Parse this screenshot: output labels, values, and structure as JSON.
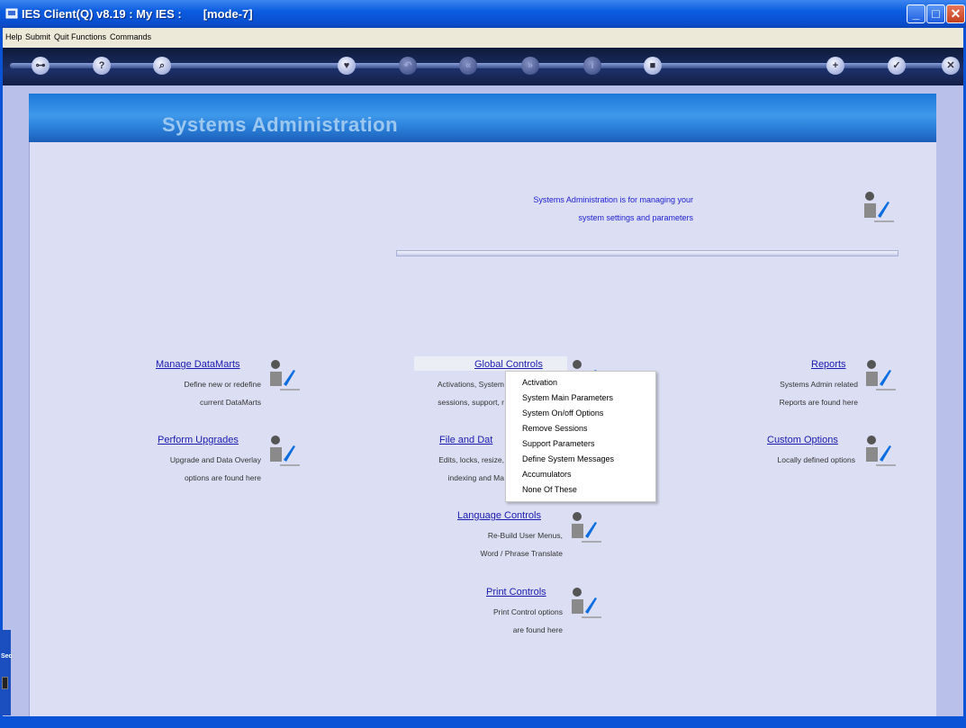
{
  "window": {
    "title": "IES Client(Q) v8.19 : My IES :",
    "mode": "[mode-7]"
  },
  "menubar": {
    "items": [
      "Help",
      "Submit",
      "Quit",
      "Functions",
      "Commands"
    ]
  },
  "toolbar": {
    "icons": [
      "key-icon",
      "help-icon",
      "search-icon",
      "heart-icon",
      "undo-icon",
      "rewind-icon",
      "forward-icon",
      "info-icon",
      "stop-icon",
      "new-icon",
      "ok-icon",
      "close-icon"
    ],
    "glyphs": [
      "⊶",
      "?",
      "⌕",
      "♥",
      "↶",
      "«",
      "»",
      "i",
      "■",
      "+",
      "✓",
      "✕"
    ]
  },
  "banner": {
    "title": "Systems Administration"
  },
  "intro": {
    "line1": "Systems Administration is for managing your",
    "line2": "system settings and parameters"
  },
  "modules": {
    "manage": {
      "title": "Manage DataMarts",
      "line1": "Define new or redefine",
      "line2": "current DataMarts"
    },
    "global": {
      "title": "Global Controls",
      "line1": "Activations, System",
      "line2": "sessions, support,  r"
    },
    "reports": {
      "title": "Reports",
      "line1": "Systems Admin related",
      "line2": "Reports are found here"
    },
    "upgrades": {
      "title": "Perform Upgrades",
      "line1": "Upgrade and Data Overlay",
      "line2": "options are found here"
    },
    "filedata": {
      "title": "File and Dat",
      "line1": "Edits, locks, resize,",
      "line2": "indexing and Ma"
    },
    "custom": {
      "title": "Custom Options",
      "line1": "Locally defined options"
    },
    "language": {
      "title": "Language Controls",
      "line1": "Re-Build User Menus,",
      "line2": "Word / Phrase Translate"
    },
    "print": {
      "title": "Print Controls",
      "line1": "Print Control options",
      "line2": "are found here"
    }
  },
  "popup": {
    "items": [
      "Activation",
      "System Main Parameters",
      "System On/off Options",
      "Remove Sessions",
      "Support Parameters",
      "Define System Messages",
      "Accumulators",
      "None Of These"
    ]
  },
  "dock": {
    "label": "Sec"
  },
  "colors": {
    "titlebar": "#0a4fd0",
    "panel": "#dcdff3",
    "banner": "#2a80da",
    "link": "#1a1ab0"
  }
}
